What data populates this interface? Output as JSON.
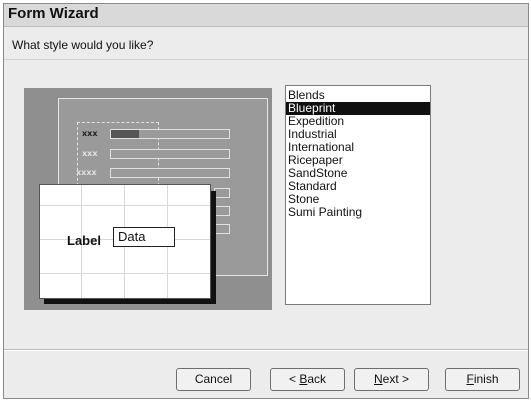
{
  "window": {
    "title": "Form Wizard"
  },
  "prompt": "What style would you like?",
  "preview": {
    "row_labels": [
      "xxx",
      "xxx",
      "xxxx"
    ],
    "card_label": "Label",
    "card_data": "Data"
  },
  "styles": {
    "items": [
      "Blends",
      "Blueprint",
      "Expedition",
      "Industrial",
      "International",
      "Ricepaper",
      "SandStone",
      "Standard",
      "Stone",
      "Sumi Painting"
    ],
    "selected_index": 1
  },
  "buttons": {
    "cancel": "Cancel",
    "back_prefix": "< ",
    "back_mnemonic": "B",
    "back_rest": "ack",
    "next_mnemonic": "N",
    "next_rest": "ext >",
    "finish_mnemonic": "F",
    "finish_rest": "inish"
  }
}
